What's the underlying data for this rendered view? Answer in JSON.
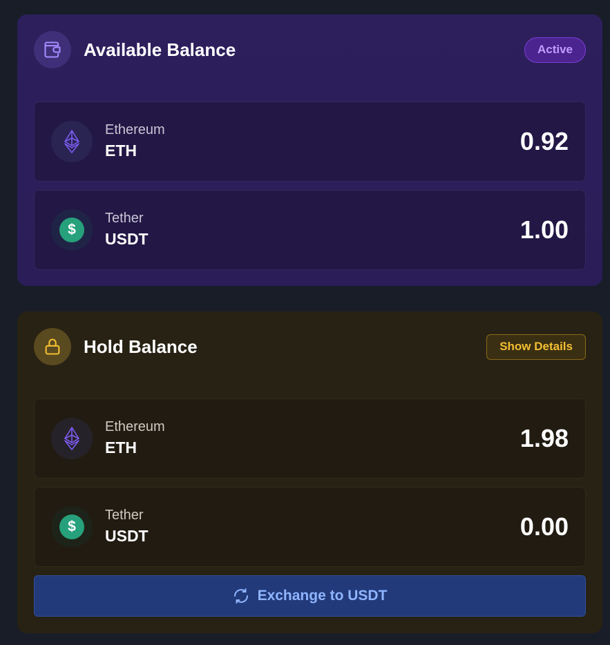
{
  "available": {
    "title": "Available Balance",
    "badge": "Active",
    "icon": "wallet-icon",
    "rows": [
      {
        "name": "Ethereum",
        "symbol": "ETH",
        "amount": "0.92",
        "icon": "ethereum-icon"
      },
      {
        "name": "Tether",
        "symbol": "USDT",
        "amount": "1.00",
        "icon": "dollar-icon"
      }
    ]
  },
  "hold": {
    "title": "Hold Balance",
    "badge": "Show Details",
    "icon": "lock-icon",
    "rows": [
      {
        "name": "Ethereum",
        "symbol": "ETH",
        "amount": "1.98",
        "icon": "ethereum-icon"
      },
      {
        "name": "Tether",
        "symbol": "USDT",
        "amount": "0.00",
        "icon": "dollar-icon"
      }
    ],
    "exchange_label": "Exchange to USDT",
    "exchange_icon": "refresh-icon"
  },
  "usdt_glyph": "$",
  "colors": {
    "background": "#181d28",
    "available_card": "#2d1f5c",
    "hold_card": "#282214",
    "eth_purple": "#7c5cf0",
    "usdt_green": "#26a17b",
    "active_badge_text": "#c59bff",
    "details_badge_text": "#f3bf32",
    "exchange_button": "#223a7a",
    "exchange_text": "#8fb4ff"
  }
}
